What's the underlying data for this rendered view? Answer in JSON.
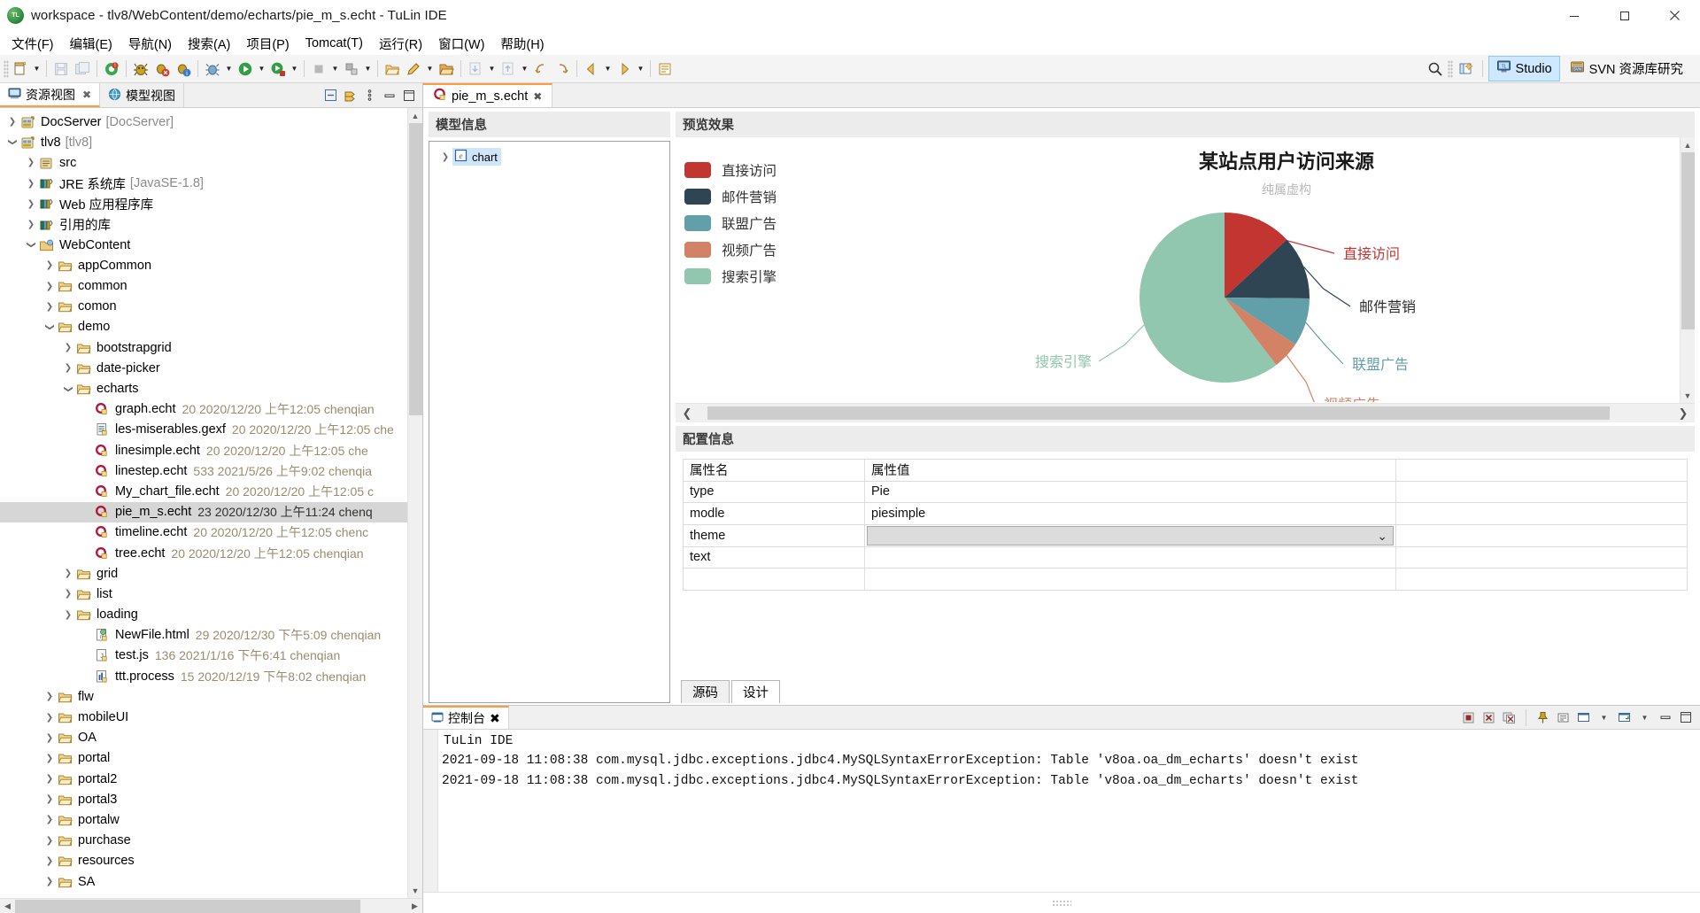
{
  "window": {
    "title": "workspace - tlv8/WebContent/demo/echarts/pie_m_s.echt - TuLin IDE",
    "logo_text": "TL",
    "minimize": "–",
    "maximize": "❐",
    "close": "✕"
  },
  "menubar": {
    "items": [
      {
        "text": "文件(F)",
        "key": "F"
      },
      {
        "text": "编辑(E)",
        "key": "E"
      },
      {
        "text": "导航(N)",
        "key": "N"
      },
      {
        "text": "搜索(A)",
        "key": "A"
      },
      {
        "text": "项目(P)",
        "key": "P"
      },
      {
        "text": "Tomcat(T)",
        "key": "T"
      },
      {
        "text": "运行(R)",
        "key": "R"
      },
      {
        "text": "窗口(W)",
        "key": "W"
      },
      {
        "text": "帮助(H)",
        "key": "H"
      }
    ]
  },
  "toolbar": {
    "perspective_studio": "Studio",
    "perspective_svn": "SVN 资源库研究",
    "search_icon": "search-icon",
    "open_perspective_icon": "open-perspective-icon"
  },
  "left_panel": {
    "tabs": [
      {
        "label": "资源视图",
        "icon": "resource-view-icon",
        "active": true,
        "closable": true
      },
      {
        "label": "模型视图",
        "icon": "model-view-icon",
        "active": false,
        "closable": false
      }
    ],
    "tools": [
      "collapse-all-icon",
      "link-editor-icon",
      "view-menu-icon",
      "minimize-icon",
      "maximize-icon"
    ],
    "tree": [
      {
        "indent": 0,
        "twisty": "collapsed",
        "icon": "project-closed-icon",
        "label": "DocServer",
        "project": "[DocServer]"
      },
      {
        "indent": 0,
        "twisty": "expanded",
        "icon": "project-open-icon",
        "label": "tlv8",
        "project": "[tlv8]"
      },
      {
        "indent": 1,
        "twisty": "collapsed",
        "icon": "source-folder-icon",
        "label": "src",
        "project": ""
      },
      {
        "indent": 1,
        "twisty": "collapsed",
        "icon": "library-icon",
        "label": "JRE 系统库",
        "project": "[JavaSE-1.8]"
      },
      {
        "indent": 1,
        "twisty": "collapsed",
        "icon": "library-icon",
        "label": "Web 应用程序库",
        "project": ""
      },
      {
        "indent": 1,
        "twisty": "collapsed",
        "icon": "library-icon",
        "label": "引用的库",
        "project": ""
      },
      {
        "indent": 1,
        "twisty": "expanded",
        "icon": "webcontent-folder-icon",
        "label": "WebContent",
        "project": ""
      },
      {
        "indent": 2,
        "twisty": "collapsed",
        "icon": "folder-icon",
        "label": "appCommon",
        "project": ""
      },
      {
        "indent": 2,
        "twisty": "collapsed",
        "icon": "folder-icon",
        "label": "common",
        "project": ""
      },
      {
        "indent": 2,
        "twisty": "collapsed",
        "icon": "folder-icon",
        "label": "comon",
        "project": ""
      },
      {
        "indent": 2,
        "twisty": "expanded",
        "icon": "folder-icon",
        "label": "demo",
        "project": ""
      },
      {
        "indent": 3,
        "twisty": "collapsed",
        "icon": "folder-icon",
        "label": "bootstrapgrid",
        "project": ""
      },
      {
        "indent": 3,
        "twisty": "collapsed",
        "icon": "folder-icon",
        "label": "date-picker",
        "project": ""
      },
      {
        "indent": 3,
        "twisty": "expanded",
        "icon": "folder-icon",
        "label": "echarts",
        "project": ""
      },
      {
        "indent": 4,
        "twisty": "none",
        "icon": "echt-file-icon",
        "label": "graph.echt",
        "meta": "20  2020/12/20 上午12:05  chenqian"
      },
      {
        "indent": 4,
        "twisty": "none",
        "icon": "xml-file-icon",
        "label": "les-miserables.gexf",
        "meta": "20  2020/12/20 上午12:05  che"
      },
      {
        "indent": 4,
        "twisty": "none",
        "icon": "echt-file-icon",
        "label": "linesimple.echt",
        "meta": "20  2020/12/20 上午12:05  che"
      },
      {
        "indent": 4,
        "twisty": "none",
        "icon": "echt-file-icon",
        "label": "linestep.echt",
        "meta": "533  2021/5/26 上午9:02  chenqia"
      },
      {
        "indent": 4,
        "twisty": "none",
        "icon": "echt-file-icon",
        "label": "My_chart_file.echt",
        "meta": "20  2020/12/20 上午12:05  c"
      },
      {
        "indent": 4,
        "twisty": "none",
        "icon": "echt-file-icon",
        "label": "pie_m_s.echt",
        "meta": "23  2020/12/30 上午11:24  chenq",
        "selected": true
      },
      {
        "indent": 4,
        "twisty": "none",
        "icon": "echt-file-icon",
        "label": "timeline.echt",
        "meta": "20  2020/12/20 上午12:05  chenc"
      },
      {
        "indent": 4,
        "twisty": "none",
        "icon": "echt-file-icon",
        "label": "tree.echt",
        "meta": "20  2020/12/20 上午12:05  chenqian"
      },
      {
        "indent": 3,
        "twisty": "collapsed",
        "icon": "folder-icon",
        "label": "grid",
        "project": ""
      },
      {
        "indent": 3,
        "twisty": "collapsed",
        "icon": "folder-icon",
        "label": "list",
        "project": ""
      },
      {
        "indent": 3,
        "twisty": "collapsed",
        "icon": "folder-icon",
        "label": "loading",
        "project": ""
      },
      {
        "indent": 4,
        "twisty": "none",
        "icon": "html-file-icon",
        "label": "NewFile.html",
        "meta": "29  2020/12/30 下午5:09  chenqian"
      },
      {
        "indent": 4,
        "twisty": "none",
        "icon": "js-file-icon",
        "label": "test.js",
        "meta": "136  2021/1/16 下午6:41  chenqian"
      },
      {
        "indent": 4,
        "twisty": "none",
        "icon": "process-file-icon",
        "label": "ttt.process",
        "meta": "15  2020/12/19 下午8:02  chenqian"
      },
      {
        "indent": 2,
        "twisty": "collapsed",
        "icon": "folder-icon",
        "label": "flw",
        "project": ""
      },
      {
        "indent": 2,
        "twisty": "collapsed",
        "icon": "folder-icon",
        "label": "mobileUI",
        "project": ""
      },
      {
        "indent": 2,
        "twisty": "collapsed",
        "icon": "folder-icon",
        "label": "OA",
        "project": ""
      },
      {
        "indent": 2,
        "twisty": "collapsed",
        "icon": "folder-icon",
        "label": "portal",
        "project": ""
      },
      {
        "indent": 2,
        "twisty": "collapsed",
        "icon": "folder-icon",
        "label": "portal2",
        "project": ""
      },
      {
        "indent": 2,
        "twisty": "collapsed",
        "icon": "folder-icon",
        "label": "portal3",
        "project": ""
      },
      {
        "indent": 2,
        "twisty": "collapsed",
        "icon": "folder-icon",
        "label": "portalw",
        "project": ""
      },
      {
        "indent": 2,
        "twisty": "collapsed",
        "icon": "folder-icon",
        "label": "purchase",
        "project": ""
      },
      {
        "indent": 2,
        "twisty": "collapsed",
        "icon": "folder-icon",
        "label": "resources",
        "project": ""
      },
      {
        "indent": 2,
        "twisty": "collapsed",
        "icon": "folder-icon",
        "label": "SA",
        "project": ""
      }
    ]
  },
  "editor": {
    "tab": {
      "label": "pie_m_s.echt",
      "icon": "echt-file-icon",
      "close": "✕"
    },
    "model_section_title": "模型信息",
    "model_node": {
      "label": "chart",
      "icon": "element-icon",
      "twisty": "collapsed"
    },
    "preview_section_title": "预览效果",
    "config_section_title": "配置信息",
    "bottom_tabs": [
      {
        "label": "源码",
        "active": false
      },
      {
        "label": "设计",
        "active": true
      }
    ],
    "properties": {
      "header": {
        "name": "属性名",
        "value": "属性值"
      },
      "rows": [
        {
          "name": "type",
          "value": "Pie",
          "type": "text"
        },
        {
          "name": "modle",
          "value": "piesimple",
          "type": "text"
        },
        {
          "name": "theme",
          "value": "",
          "type": "combo"
        },
        {
          "name": "text",
          "value": "",
          "type": "text"
        },
        {
          "name": "",
          "value": "",
          "type": "text"
        }
      ]
    }
  },
  "chart_data": {
    "type": "pie",
    "title": "某站点用户访问来源",
    "subtitle": "纯属虚构",
    "legend_position": "left",
    "categories": [
      "直接访问",
      "邮件营销",
      "联盟广告",
      "视频广告",
      "搜索引擎"
    ],
    "values": [
      335,
      310,
      234,
      135,
      1548
    ],
    "colors": [
      "#c23531",
      "#2f4554",
      "#61a0a8",
      "#d48265",
      "#91c7ae"
    ],
    "labels": [
      {
        "name": "直接访问",
        "color": "#c23531"
      },
      {
        "name": "邮件营销",
        "color": "#2f4554"
      },
      {
        "name": "联盟广告",
        "color": "#61a0a8"
      },
      {
        "name": "视频广告",
        "color": "#d48265"
      },
      {
        "name": "搜索引擎",
        "color": "#91c7ae"
      }
    ]
  },
  "console": {
    "tab_label": "控制台",
    "tab_icon": "console-icon",
    "tools": [
      "terminate-icon",
      "remove-launch-icon",
      "remove-all-icon",
      "pin-icon",
      "display-selected-icon",
      "dropdown-icon",
      "open-console-icon",
      "dropdown2-icon",
      "minimize-icon",
      "maximize-icon"
    ],
    "header": "TuLin IDE",
    "lines": [
      "2021-09-18 11:08:38  com.mysql.jdbc.exceptions.jdbc4.MySQLSyntaxErrorException: Table 'v8oa.oa_dm_echarts' doesn't exist",
      "2021-09-18 11:08:38  com.mysql.jdbc.exceptions.jdbc4.MySQLSyntaxErrorException: Table 'v8oa.oa_dm_echarts' doesn't exist"
    ]
  }
}
